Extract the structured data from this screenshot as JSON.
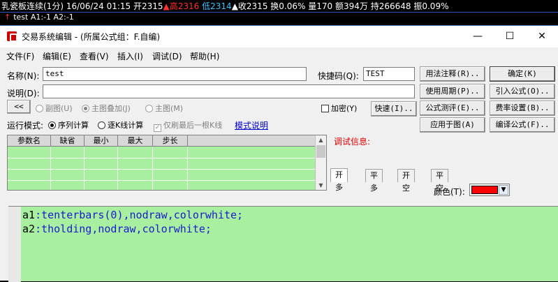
{
  "ticker": {
    "name": "乳瓷板连续(1分)",
    "date": "16/06/24",
    "time": "01:15",
    "open_label": "开2315",
    "high_label": "▲高2316",
    "low_label": "低2314",
    "close_label": "▲收2315",
    "change": "换0.06%",
    "volume": "量170",
    "amount": "额394万",
    "hold": "持266648",
    "amplitude": "振0.09%"
  },
  "subbar": {
    "arrow": "↑",
    "text": "test  A1:-1  A2:-1"
  },
  "window": {
    "title": "交易系统编辑 - (所属公式组：F.自编)",
    "minimize": "—",
    "maximize": "☐",
    "close": "✕"
  },
  "menu": [
    "文件(F)",
    "编辑(E)",
    "查看(V)",
    "插入(I)",
    "调试(D)",
    "帮助(H)"
  ],
  "form": {
    "name_label": "名称(N):",
    "name_value": "test",
    "shortcut_label": "快捷码(Q):",
    "shortcut_value": "TEST",
    "desc_label": "说明(D):",
    "desc_value": ""
  },
  "buttons": {
    "usage_note": "用法注释(R)..",
    "ok": "确定(K)",
    "use_period": "使用周期(P)..",
    "import_formula": "引入公式(O)..",
    "quick": "快速(I)..",
    "formula_eval": "公式测评(E)..",
    "fee_settings": "费率设置(B)..",
    "apply_to_chart": "应用于图(A)",
    "compile": "编译公式(F)..",
    "collapse": "<<"
  },
  "radios": {
    "sub_chart": "副图(U)",
    "main_overlay": "主图叠加(J)",
    "main_chart": "主图(M)"
  },
  "encrypt_label": "加密(Y)",
  "run_mode": {
    "label": "运行模式:",
    "sequential": "序列计算",
    "tick": "逐K线计算",
    "last_bar_only": "仅刷最后一根K线",
    "mode_help": "模式说明"
  },
  "param_table": {
    "headers": [
      "参数名",
      "缺省",
      "最小",
      "最大",
      "步长"
    ]
  },
  "debug_label": "调试信息:",
  "tabs": [
    "开多",
    "平多",
    "开空",
    "平空"
  ],
  "color_label": "颜色(T):",
  "color_value": "#ff0000",
  "code": {
    "line1": {
      "id": "a1",
      "rest": ":tenterbars(0),nodraw,colorwhite;"
    },
    "line2": {
      "id": "a2",
      "rest": ":tholding,nodraw,colorwhite;"
    }
  }
}
